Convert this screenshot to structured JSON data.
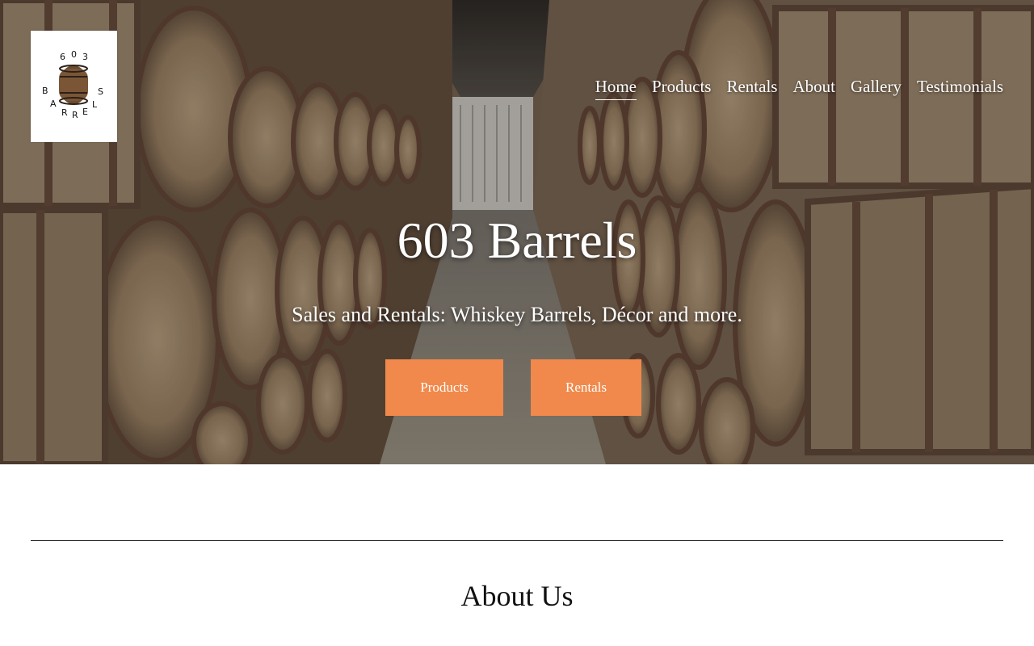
{
  "logo": {
    "alt": "603 Barrels logo",
    "letters": [
      "6",
      "0",
      "3",
      "B",
      "A",
      "R",
      "R",
      "E",
      "L",
      "S"
    ]
  },
  "nav": {
    "items": [
      {
        "label": "Home",
        "active": true
      },
      {
        "label": "Products",
        "active": false
      },
      {
        "label": "Rentals",
        "active": false
      },
      {
        "label": "About",
        "active": false
      },
      {
        "label": "Gallery",
        "active": false
      },
      {
        "label": "Testimonials",
        "active": false
      }
    ]
  },
  "hero": {
    "title": "603 Barrels",
    "subtitle": "Sales and Rentals: Whiskey Barrels, Décor and more.",
    "buttons": {
      "products": "Products",
      "rentals": "Rentals"
    }
  },
  "about": {
    "title": "About Us"
  },
  "colors": {
    "accent": "#f0894b",
    "nav_text": "#ffffff",
    "background": "#ffffff"
  }
}
